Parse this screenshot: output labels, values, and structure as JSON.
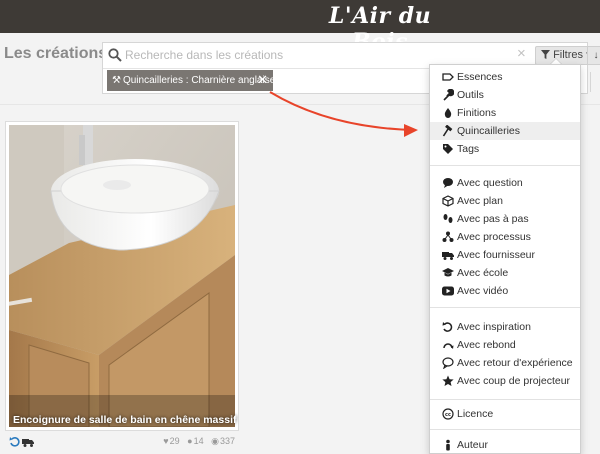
{
  "brand": "L'Air du Bois",
  "page_title": "Les créations",
  "search": {
    "placeholder": "Recherche dans les créations",
    "value": "",
    "clear_glyph": "×",
    "filter_label": "Filtres",
    "sort_glyph": "↓"
  },
  "active_tag": {
    "label": "Quincailleries : Charnière anglaise",
    "remove_glyph": "✕"
  },
  "card": {
    "title": "Encoignure de salle de bain en chêne massif",
    "likes": "29",
    "comments": "14",
    "views": "337"
  },
  "filter_menu": {
    "items": [
      {
        "label": "Essences",
        "icon": "tag-outline-icon"
      },
      {
        "label": "Outils",
        "icon": "wrench-icon"
      },
      {
        "label": "Finitions",
        "icon": "drop-icon"
      },
      {
        "label": "Quincailleries",
        "icon": "hammer-icon",
        "active": true
      },
      {
        "label": "Tags",
        "icon": "tags-icon"
      },
      {
        "label": "Avec question",
        "icon": "speech-bubble-icon"
      },
      {
        "label": "Avec plan",
        "icon": "cube-icon"
      },
      {
        "label": "Avec pas à pas",
        "icon": "footprints-icon"
      },
      {
        "label": "Avec processus",
        "icon": "process-icon"
      },
      {
        "label": "Avec fournisseur",
        "icon": "truck-icon"
      },
      {
        "label": "Avec école",
        "icon": "graduation-cap-icon"
      },
      {
        "label": "Avec vidéo",
        "icon": "play-icon"
      },
      {
        "label": "Avec inspiration",
        "icon": "undo-arrow-icon"
      },
      {
        "label": "Avec rebond",
        "icon": "rebound-icon"
      },
      {
        "label": "Avec retour d'expérience",
        "icon": "chat-question-icon"
      },
      {
        "label": "Avec coup de projecteur",
        "icon": "star-icon"
      },
      {
        "label": "Licence",
        "icon": "cc-license-icon"
      },
      {
        "label": "Auteur",
        "icon": "person-icon"
      }
    ]
  },
  "colors": {
    "topbar": "#3e3a36",
    "chip": "#7a7672",
    "arrow": "#e8442a"
  }
}
